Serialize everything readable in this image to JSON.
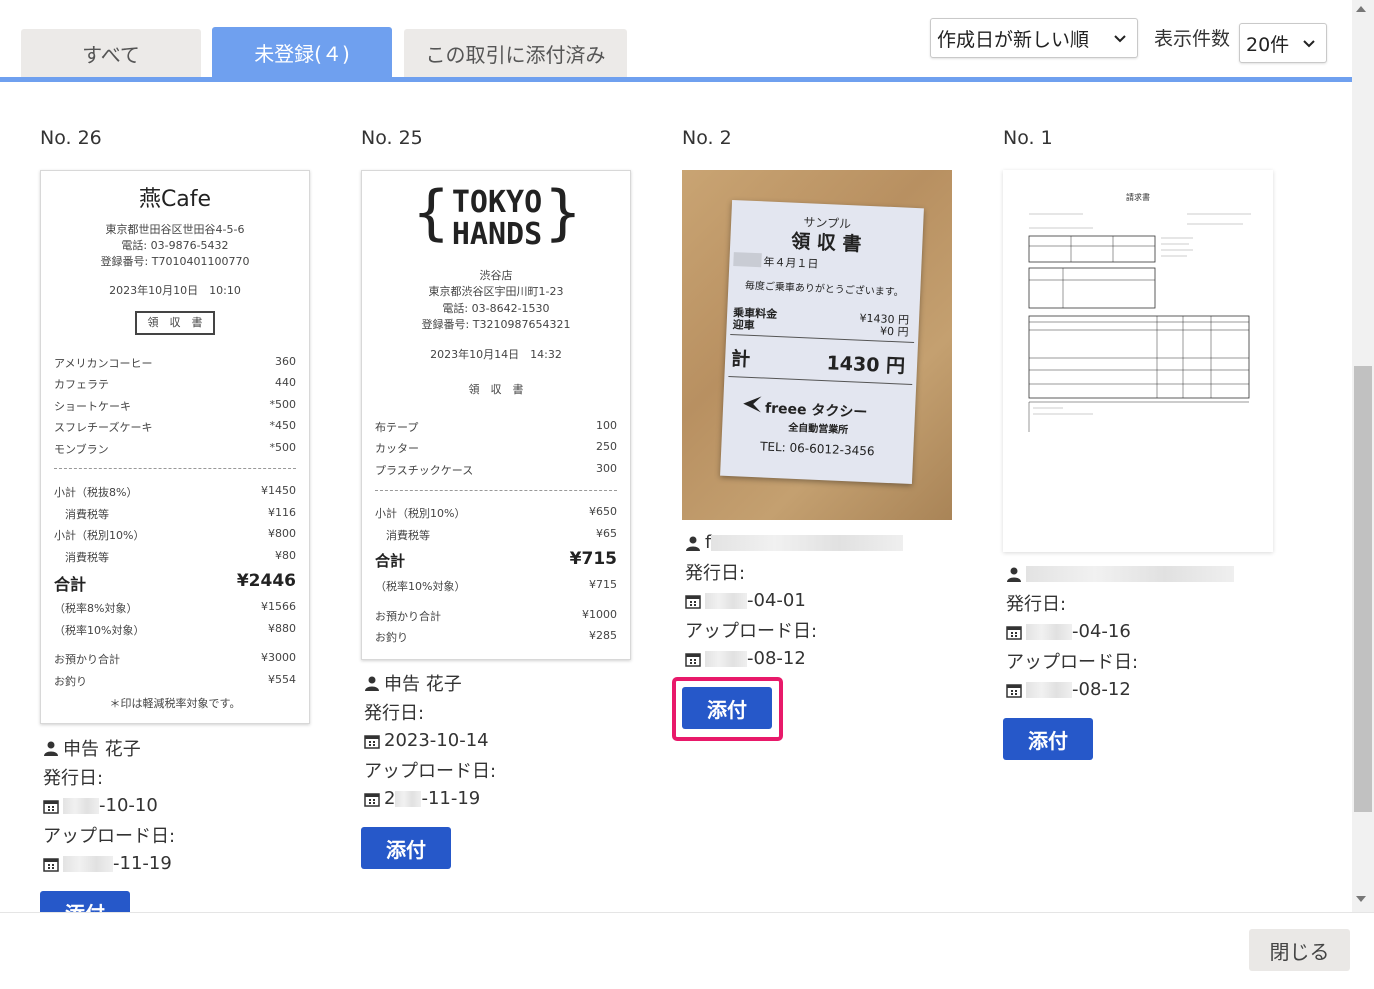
{
  "tabs": [
    {
      "label": "すべて"
    },
    {
      "label": "未登録(４)"
    },
    {
      "label": "この取引に添付済み"
    }
  ],
  "sort_select": {
    "value": "作成日が新しい順"
  },
  "count_label": "表示件数",
  "count_select": {
    "value": "20件"
  },
  "cards": [
    {
      "no": "No. 26",
      "user": "申告 花子",
      "issue_label": "発行日:",
      "issue_date": "-10-10",
      "upload_label": "アップロード日:",
      "upload_date": "-11-19",
      "attach_label": "添付",
      "receipt": {
        "store": "燕Cafe",
        "address": "東京都世田谷区世田谷4-5-6",
        "phone": "電話: 03-9876-5432",
        "reg_no": "登録番号: T7010401100770",
        "datetime": "2023年10月10日　10:10",
        "doc_title": "領　収　書",
        "items": [
          {
            "name": "アメリカンコーヒー",
            "price": "360"
          },
          {
            "name": "カフェラテ",
            "price": "440"
          },
          {
            "name": "ショートケーキ",
            "price": "*500"
          },
          {
            "name": "スフレチーズケーキ",
            "price": "*450"
          },
          {
            "name": "モンブラン",
            "price": "*500"
          }
        ],
        "sub8_label": "小計（税抜8%）",
        "sub8": "¥1450",
        "tax_label": "消費税等",
        "tax8": "¥116",
        "sub10_label": "小計（税別10%）",
        "sub10": "¥800",
        "tax10": "¥80",
        "total_label": "合計",
        "total": "¥2446",
        "t8_label": "（税率8%対象）",
        "t8": "¥1566",
        "t10_label": "（税率10%対象）",
        "t10": "¥880",
        "paid_label": "お預かり合計",
        "paid": "¥3000",
        "change_label": "お釣り",
        "change": "¥554",
        "note": "＊印は軽減税率対象です。"
      }
    },
    {
      "no": "No. 25",
      "user": "申告 花子",
      "issue_label": "発行日:",
      "issue_date": "2023-10-14",
      "upload_label": "アップロード日:",
      "upload_date": "-11-19",
      "upload_prefix": "2",
      "attach_label": "添付",
      "receipt": {
        "logo_line1": "TOKYO",
        "logo_line2": "HANDS",
        "branch": "渋谷店",
        "address": "東京都渋谷区宇田川町1-23",
        "phone": "電話: 03-8642-1530",
        "reg_no": "登録番号: T3210987654321",
        "datetime": "2023年10月14日　14:32",
        "doc_title": "領　収　書",
        "items": [
          {
            "name": "布テープ",
            "price": "100"
          },
          {
            "name": "カッター",
            "price": "250"
          },
          {
            "name": "プラスチックケース",
            "price": "300"
          }
        ],
        "sub_label": "小計（税別10%）",
        "sub": "¥650",
        "tax_label": "消費税等",
        "tax": "¥65",
        "total_label": "合計",
        "total": "¥715",
        "t10_label": "（税率10%対象）",
        "t10": "¥715",
        "paid_label": "お預かり合計",
        "paid": "¥1000",
        "change_label": "お釣り",
        "change": "¥285"
      }
    },
    {
      "no": "No. 2",
      "issue_label": "発行日:",
      "issue_date": "-04-01",
      "upload_label": "アップロード日:",
      "upload_date": "-08-12",
      "user_prefix": "f",
      "attach_label": "添付",
      "receipt": {
        "sample": "サンプル",
        "doc_title": "領 収 書",
        "date": "年４月１日",
        "thanks": "毎度ご乗車ありがとうございます。",
        "fare_label": "乗車料金",
        "fare": "¥1430 円",
        "pickup_label": "迎車",
        "pickup": "¥0 円",
        "total_label": "計",
        "total": "1430 円",
        "brand": "freee タクシー",
        "office": "全自動営業所",
        "tel": "TEL: 06-6012-3456"
      }
    },
    {
      "no": "No. 1",
      "issue_label": "発行日:",
      "issue_date": "-04-16",
      "upload_label": "アップロード日:",
      "upload_date": "-08-12",
      "attach_label": "添付",
      "invoice": {
        "title": "請求書"
      }
    }
  ],
  "close_label": "閉じる",
  "colors": {
    "accent": "#6fa0ef",
    "button": "#2658c9",
    "highlight": "#e8196a"
  }
}
